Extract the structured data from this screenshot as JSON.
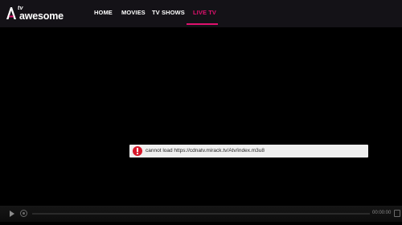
{
  "header": {
    "logo": {
      "tv_text": "tv",
      "word": "awesome"
    },
    "nav": [
      {
        "label": "HOME",
        "active": false
      },
      {
        "label": "MOVIES",
        "active": false
      },
      {
        "label": "TV SHOWS",
        "active": false
      },
      {
        "label": "LIVE TV",
        "active": true
      }
    ]
  },
  "player": {
    "error_message": "cannot load https://cdnatv.mirack.tv/Atv/index.m3u8",
    "time_display": "00:00:00",
    "controls": {
      "play_icon": "play-icon",
      "replay_icon": "replay-icon",
      "fullscreen_icon": "fullscreen-icon"
    }
  },
  "colors": {
    "accent": "#e0116e",
    "header_bg": "#141217",
    "error_icon": "#d7182a"
  }
}
